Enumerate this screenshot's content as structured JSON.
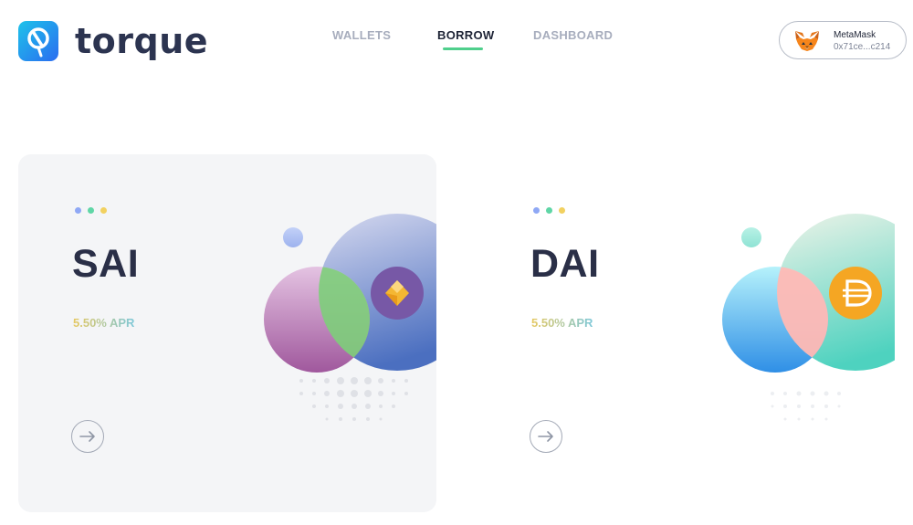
{
  "brand": {
    "name": "torque"
  },
  "nav": {
    "items": [
      "WALLETS",
      "BORROW",
      "DASHBOARD"
    ],
    "active": "BORROW"
  },
  "wallet": {
    "name": "MetaMask",
    "address": "0x71ce...c214",
    "icon": "metamask-fox-icon"
  },
  "cards": [
    {
      "coin": "SAI",
      "apr": "5.50% APR",
      "icon": "sai-diamond-icon",
      "arrow_icon": "arrow-right-icon"
    },
    {
      "coin": "DAI",
      "apr": "5.50% APR",
      "icon": "dai-dollar-icon",
      "arrow_icon": "arrow-right-icon"
    }
  ],
  "colors": {
    "accent_underline": "#4fcf8c",
    "heading": "#2a2f47",
    "dot_blue": "#8fa8f5",
    "dot_green": "#5fd6a6",
    "dot_yellow": "#f2d160"
  }
}
